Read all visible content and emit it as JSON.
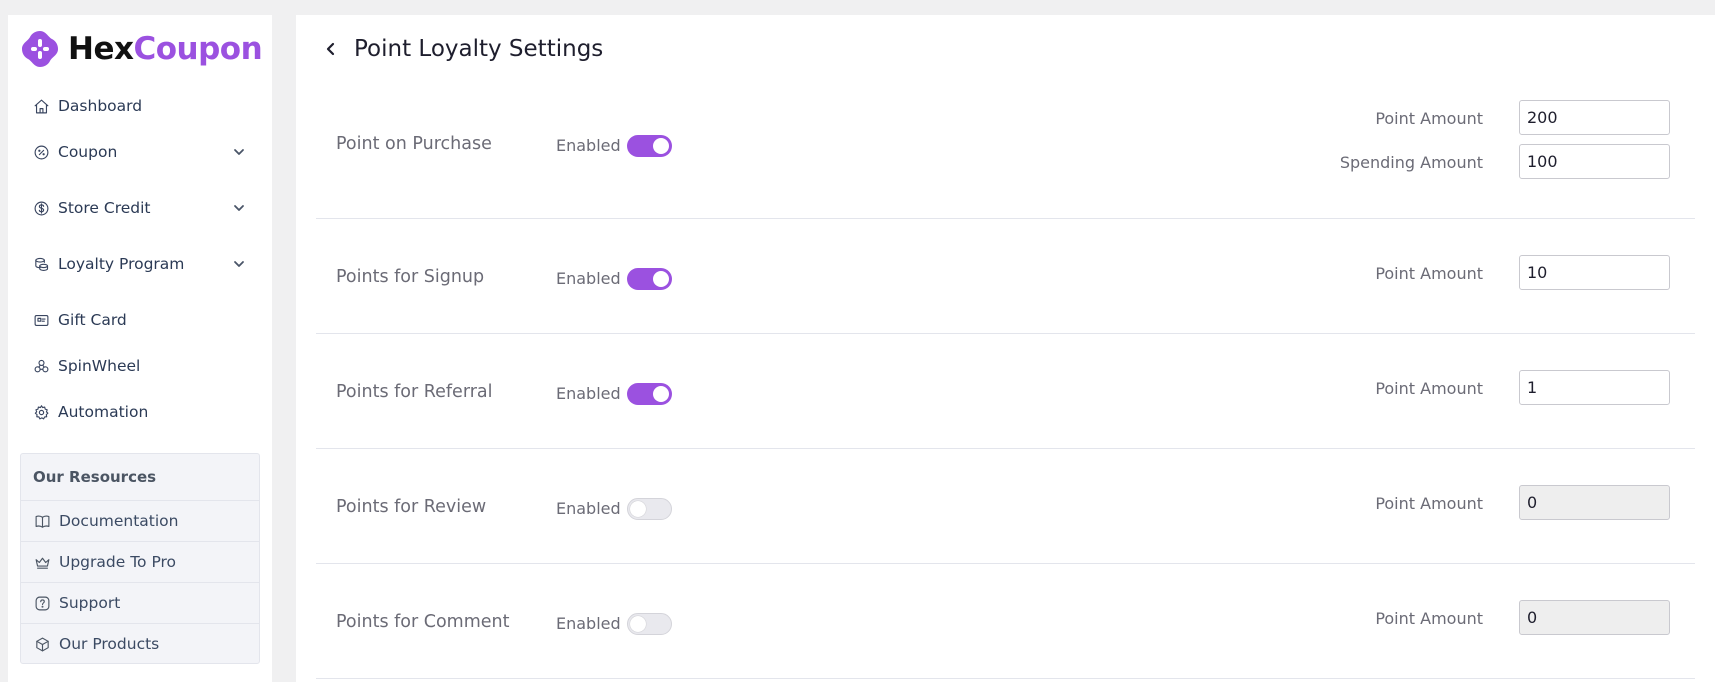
{
  "brand": {
    "name_part1": "Hex",
    "name_part2": "Coupon",
    "accent_color": "#9b51e0"
  },
  "sidebar": {
    "items": [
      {
        "label": "Dashboard",
        "icon": "home-icon",
        "expandable": false
      },
      {
        "label": "Coupon",
        "icon": "percent-icon",
        "expandable": true
      },
      {
        "label": "Store Credit",
        "icon": "dollar-icon",
        "expandable": true
      },
      {
        "label": "Loyalty Program",
        "icon": "coins-icon",
        "expandable": true
      },
      {
        "label": "Gift Card",
        "icon": "gift-card-icon",
        "expandable": false
      },
      {
        "label": "SpinWheel",
        "icon": "spinwheel-icon",
        "expandable": false
      },
      {
        "label": "Automation",
        "icon": "gear-icon",
        "expandable": false
      }
    ],
    "resources": {
      "title": "Our Resources",
      "items": [
        {
          "label": "Documentation",
          "icon": "book-icon"
        },
        {
          "label": "Upgrade To Pro",
          "icon": "crown-icon"
        },
        {
          "label": "Support",
          "icon": "help-icon"
        },
        {
          "label": "Our Products",
          "icon": "box-icon"
        }
      ]
    }
  },
  "main": {
    "title": "Point Loyalty Settings",
    "rows": [
      {
        "label": "Point on Purchase",
        "enabled_label": "Enabled",
        "enabled": true,
        "fields": [
          {
            "label": "Point Amount",
            "value": "200",
            "disabled": false
          },
          {
            "label": "Spending Amount",
            "value": "100",
            "disabled": false
          }
        ]
      },
      {
        "label": "Points for Signup",
        "enabled_label": "Enabled",
        "enabled": true,
        "fields": [
          {
            "label": "Point Amount",
            "value": "10",
            "disabled": false
          }
        ]
      },
      {
        "label": "Points for Referral",
        "enabled_label": "Enabled",
        "enabled": true,
        "fields": [
          {
            "label": "Point Amount",
            "value": "1",
            "disabled": false
          }
        ]
      },
      {
        "label": "Points for Review",
        "enabled_label": "Enabled",
        "enabled": false,
        "fields": [
          {
            "label": "Point Amount",
            "value": "0",
            "disabled": true
          }
        ]
      },
      {
        "label": "Points for Comment",
        "enabled_label": "Enabled",
        "enabled": false,
        "fields": [
          {
            "label": "Point Amount",
            "value": "0",
            "disabled": true
          }
        ]
      }
    ]
  }
}
